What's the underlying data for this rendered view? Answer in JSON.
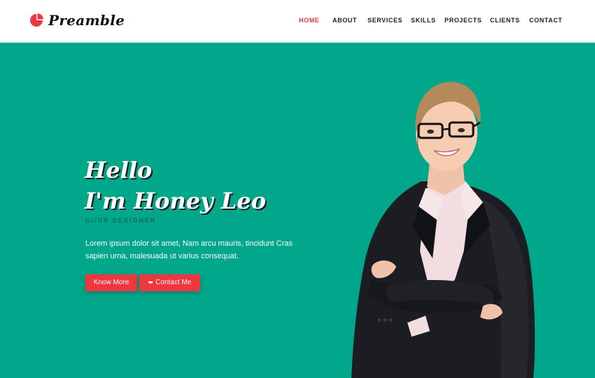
{
  "brand": {
    "name": "Preamble",
    "logo_icon": "pie-chart-icon",
    "accent": "#f0363f"
  },
  "nav": {
    "items": [
      {
        "label": "HOME",
        "active": true
      },
      {
        "label": "ABOUT",
        "active": false
      },
      {
        "label": "SERVICES",
        "active": false
      },
      {
        "label": "SKILLS",
        "active": false
      },
      {
        "label": "PROJECTS",
        "active": false
      },
      {
        "label": "CLIENTS",
        "active": false
      },
      {
        "label": "CONTACT",
        "active": false
      }
    ]
  },
  "hero": {
    "background": "#00a78b",
    "greeting_line1": "Hello",
    "greeting_line2": "I'm Honey Leo",
    "role": "UI/UX DESIGNER",
    "description": "Lorem ipsum dolor sit amet, Nam arcu mauris, tincidunt Cras sapien urna, malesuada ut varius consequat.",
    "buttons": {
      "know_more": "Know More",
      "contact_me": "Contact Me",
      "contact_icon": "chevron-down-double-icon"
    },
    "image": "businesswoman-portrait"
  }
}
